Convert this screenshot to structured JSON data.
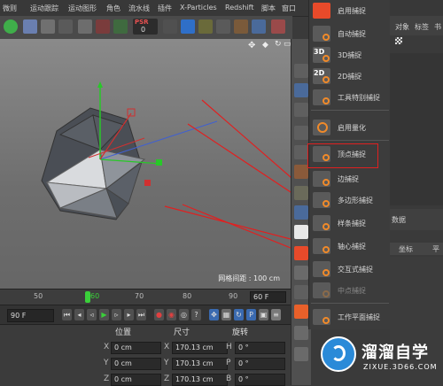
{
  "menu": {
    "items": [
      "微则",
      "运动跟踪",
      "运动图形",
      "角色",
      "流水线",
      "插件",
      "X-Particles",
      "Redshift",
      "脚本",
      "窗口"
    ]
  },
  "toolbar": {
    "psr_badge": "PSR",
    "psr_value": "0"
  },
  "viewport": {
    "grid_label": "网格间距 : 100 cm"
  },
  "timeline": {
    "ticks": [
      "50",
      "60",
      "70",
      "80",
      "90"
    ],
    "current_frame": "60",
    "end_field": "60 F"
  },
  "playback": {
    "frame_field": "90 F"
  },
  "coordinates": {
    "headers": {
      "position": "位置",
      "size": "尺寸",
      "rotation": "旋转"
    },
    "rows": [
      {
        "axis": "X",
        "pos": "0 cm",
        "size_axis": "X",
        "size": "170.13 cm",
        "rot_axis": "H",
        "rot": "0 °"
      },
      {
        "axis": "Y",
        "pos": "0 cm",
        "size_axis": "Y",
        "size": "170.13 cm",
        "rot_axis": "P",
        "rot": "0 °"
      },
      {
        "axis": "Z",
        "pos": "0 cm",
        "size_axis": "Z",
        "size": "170.13 cm",
        "rot_axis": "B",
        "rot": "0 °"
      }
    ]
  },
  "snap_menu": {
    "items": [
      {
        "label": "启用捕捉",
        "icon": "magnet-icon"
      },
      {
        "label": "自动捕捉",
        "icon": "auto-snap-icon"
      },
      {
        "label": "3D捕捉",
        "icon": "snap-3d-icon"
      },
      {
        "label": "2D捕捉",
        "icon": "snap-2d-icon"
      },
      {
        "label": "工具特别捕捉",
        "icon": "tool-snap-icon"
      },
      {
        "label": "启用量化",
        "icon": "quantize-icon"
      },
      {
        "label": "顶点捕捉",
        "icon": "vertex-snap-icon"
      },
      {
        "label": "边捕捉",
        "icon": "edge-snap-icon"
      },
      {
        "label": "多边形捕捉",
        "icon": "polygon-snap-icon"
      },
      {
        "label": "样条捕捉",
        "icon": "spline-snap-icon"
      },
      {
        "label": "轴心捕捉",
        "icon": "axis-snap-icon"
      },
      {
        "label": "交互式捕捉",
        "icon": "interactive-snap-icon"
      },
      {
        "label": "中点捕捉",
        "icon": "midpoint-snap-icon"
      },
      {
        "label": "工作平面捕捉",
        "icon": "workplane-snap-icon"
      }
    ],
    "highlighted": "顶点捕捉"
  },
  "right_panel": {
    "menu": [
      "对象",
      "标签",
      "书"
    ],
    "section_label": "数据",
    "coord_label": "坐标",
    "coord_label2": "平"
  },
  "watermark": {
    "brand": "溜溜自学",
    "url": "ZIXUE.3D66.COM"
  },
  "colors": {
    "accent_orange": "#f08a2a",
    "highlight_red": "#e02020",
    "axis_green": "#28c828"
  }
}
